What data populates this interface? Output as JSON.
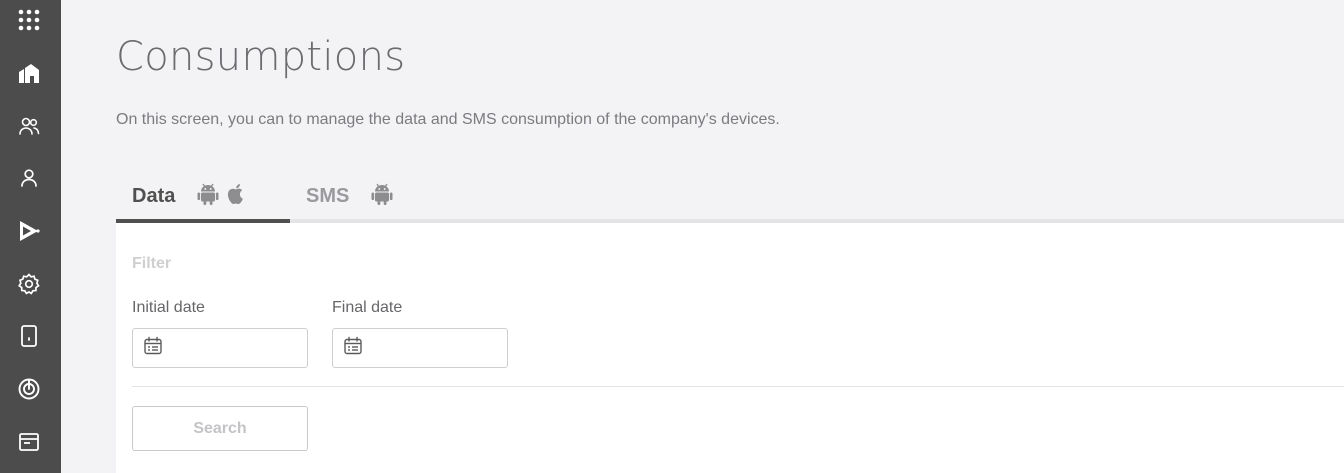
{
  "sidebar": {
    "items": [
      {
        "icon": "apps-grid-icon"
      },
      {
        "icon": "dashboard-home-icon"
      },
      {
        "icon": "groups-icon"
      },
      {
        "icon": "user-icon"
      },
      {
        "icon": "play-store-icon"
      },
      {
        "icon": "settings-gear-icon"
      },
      {
        "icon": "device-icon"
      },
      {
        "icon": "location-radar-icon"
      },
      {
        "icon": "browser-window-icon"
      }
    ]
  },
  "page": {
    "title": "Consumptions",
    "subtitle": "On this screen, you can to manage the data and SMS consumption of the company's devices."
  },
  "tabs": [
    {
      "label": "Data",
      "active": true,
      "icons": [
        "android-icon",
        "apple-icon"
      ]
    },
    {
      "label": "SMS",
      "active": false,
      "icons": [
        "android-icon"
      ]
    }
  ],
  "filter": {
    "heading": "Filter",
    "initial_date": {
      "label": "Initial date",
      "value": "",
      "placeholder": ""
    },
    "final_date": {
      "label": "Final date",
      "value": "",
      "placeholder": ""
    },
    "search_label": "Search"
  },
  "colors": {
    "sidebar_bg": "#4c4c4c",
    "page_bg": "#f3f3f5",
    "active_tab": "#505050"
  }
}
